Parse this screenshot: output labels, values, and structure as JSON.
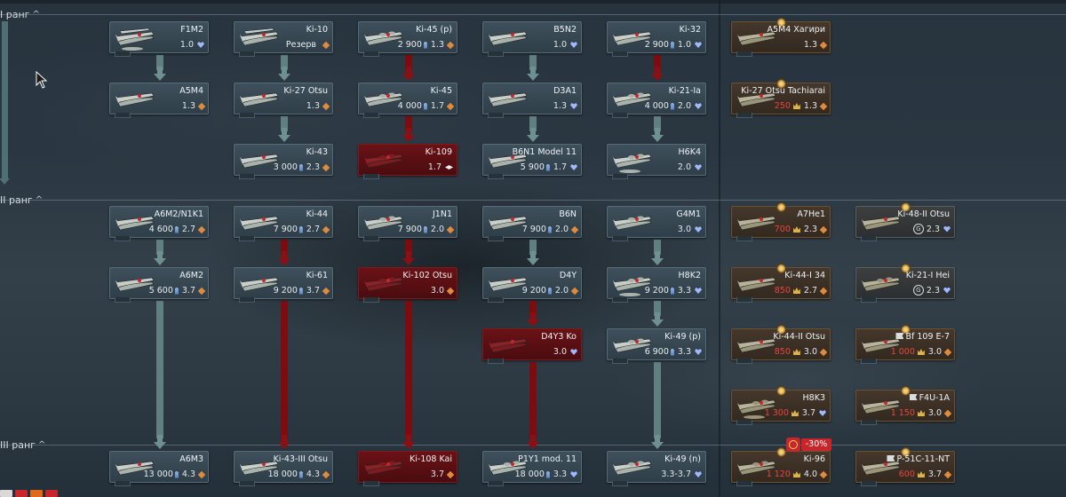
{
  "ranks": [
    {
      "id": "rank1",
      "label": "I ранг"
    },
    {
      "id": "rank2",
      "label": "II ранг"
    },
    {
      "id": "rank3",
      "label": "III ранг"
    }
  ],
  "colors": {
    "research_path": "#5f7f80",
    "premium_path": "#7b0c10",
    "card_regular": "#3a4a55",
    "card_premium_research": "#5a1014",
    "card_premium": "#3e3126",
    "discount_badge": "#c8262a",
    "crown": "#e0b24a"
  },
  "vehicles": {
    "f1m2": {
      "name": "F1M2",
      "cost": "",
      "br": "1.0",
      "type": "heart-icon",
      "plane": "biplane-float-icon"
    },
    "ki10": {
      "name": "Ki-10",
      "cost": "Резерв",
      "br": "",
      "type": "diamond-icon",
      "plane": "biplane-icon"
    },
    "ki45p": {
      "name": "Ki-45 (p)",
      "cost": "2 900",
      "br": "1.3",
      "type": "diamond-icon",
      "plane": "twin-engine-icon"
    },
    "b5n2": {
      "name": "B5N2",
      "cost": "",
      "br": "1.0",
      "type": "heart-icon",
      "plane": "torpedo-bomber-icon"
    },
    "ki32": {
      "name": "Ki-32",
      "cost": "2 900",
      "br": "1.0",
      "type": "heart-icon",
      "plane": "light-bomber-icon"
    },
    "a5m4h": {
      "name": "A5M4 Хагири",
      "cost": "",
      "br": "1.3",
      "type": "diamond-icon",
      "plane": "fighter-icon"
    },
    "a5m4": {
      "name": "A5M4",
      "cost": "",
      "br": "1.3",
      "type": "diamond-icon",
      "plane": "fighter-icon"
    },
    "ki27otsu": {
      "name": "Ki-27 Otsu",
      "cost": "",
      "br": "1.3",
      "type": "diamond-icon",
      "plane": "fighter-icon"
    },
    "ki45": {
      "name": "Ki-45",
      "cost": "4 000",
      "br": "1.7",
      "type": "diamond-icon",
      "plane": "twin-engine-icon"
    },
    "d3a1": {
      "name": "D3A1",
      "cost": "",
      "br": "1.3",
      "type": "heart-icon",
      "plane": "dive-bomber-icon"
    },
    "ki21ia": {
      "name": "Ki-21-Ia",
      "cost": "4 000",
      "br": "2.0",
      "type": "heart-icon",
      "plane": "bomber-icon"
    },
    "ki27tach": {
      "name": "Ki-27 Otsu Tachiarai",
      "cost": "250",
      "br": "1.3",
      "type": "diamond-icon",
      "plane": "fighter-icon"
    },
    "ki43": {
      "name": "Ki-43",
      "cost": "3 000",
      "br": "2.3",
      "type": "diamond-icon",
      "plane": "fighter-icon"
    },
    "ki109": {
      "name": "Ki-109",
      "cost": "",
      "br": "1.7",
      "type": "bomber-icon",
      "plane": "bomber-icon"
    },
    "b6n1": {
      "name": "B6N1 Model 11",
      "cost": "5 900",
      "br": "1.7",
      "type": "heart-icon",
      "plane": "torpedo-bomber-icon"
    },
    "h6k4": {
      "name": "H6K4",
      "cost": "",
      "br": "2.0",
      "type": "heart-icon",
      "plane": "flying-boat-icon"
    },
    "a6m2n1k1": {
      "name": "A6M2/N1K1",
      "cost": "4 600",
      "br": "2.7",
      "type": "diamond-icon",
      "plane": "fighter-icon"
    },
    "ki44": {
      "name": "Ki-44",
      "cost": "7 900",
      "br": "2.7",
      "type": "diamond-icon",
      "plane": "fighter-icon"
    },
    "j1n1": {
      "name": "J1N1",
      "cost": "7 900",
      "br": "2.0",
      "type": "diamond-icon",
      "plane": "twin-engine-icon"
    },
    "b6n": {
      "name": "B6N",
      "cost": "7 900",
      "br": "2.0",
      "type": "diamond-icon",
      "plane": "torpedo-bomber-icon"
    },
    "g4m1": {
      "name": "G4M1",
      "cost": "",
      "br": "3.0",
      "type": "heart-icon",
      "plane": "bomber-icon"
    },
    "a7he1": {
      "name": "A7He1",
      "cost": "700",
      "br": "2.3",
      "type": "diamond-icon",
      "plane": "fighter-icon"
    },
    "ki48": {
      "name": "Ki-48-II Otsu",
      "cost": "",
      "br": "2.3",
      "type": "heart-icon",
      "plane": "light-bomber-icon"
    },
    "a6m2": {
      "name": "A6M2",
      "cost": "5 600",
      "br": "3.7",
      "type": "diamond-icon",
      "plane": "fighter-icon"
    },
    "ki61": {
      "name": "Ki-61",
      "cost": "9 200",
      "br": "3.7",
      "type": "diamond-icon",
      "plane": "fighter-icon"
    },
    "ki102": {
      "name": "Ki-102 Otsu",
      "cost": "",
      "br": "3.0",
      "type": "diamond-icon",
      "plane": "twin-engine-icon"
    },
    "d4y": {
      "name": "D4Y",
      "cost": "9 200",
      "br": "2.0",
      "type": "diamond-icon",
      "plane": "dive-bomber-icon"
    },
    "h8k2": {
      "name": "H8K2",
      "cost": "9 200",
      "br": "3.3",
      "type": "heart-icon",
      "plane": "flying-boat-icon"
    },
    "ki44i34": {
      "name": "Ki-44-I 34",
      "cost": "850",
      "br": "2.7",
      "type": "diamond-icon",
      "plane": "fighter-icon"
    },
    "ki21hei": {
      "name": "Ki-21-I Hei",
      "cost": "",
      "br": "2.3",
      "type": "heart-icon",
      "plane": "bomber-icon"
    },
    "d4y3": {
      "name": "D4Y3 Ko",
      "cost": "",
      "br": "3.0",
      "type": "heart-icon",
      "plane": "dive-bomber-icon"
    },
    "ki49p": {
      "name": "Ki-49 (p)",
      "cost": "6 900",
      "br": "3.3",
      "type": "heart-icon",
      "plane": "bomber-icon"
    },
    "ki44iiotsu": {
      "name": "Ki-44-II Otsu",
      "cost": "850",
      "br": "3.0",
      "type": "diamond-icon",
      "plane": "fighter-icon"
    },
    "bf109e7": {
      "name": "Bf 109 E-7",
      "cost": "1 000",
      "br": "3.0",
      "type": "diamond-icon",
      "plane": "fighter-icon"
    },
    "h8k3": {
      "name": "H8K3",
      "cost": "1 300",
      "br": "3.7",
      "type": "heart-icon",
      "plane": "flying-boat-icon"
    },
    "f4u1a": {
      "name": "F4U-1A",
      "cost": "1 150",
      "br": "3.0",
      "type": "diamond-icon",
      "plane": "fighter-icon"
    },
    "a6m3": {
      "name": "A6M3",
      "cost": "13 000",
      "br": "4.3",
      "type": "diamond-icon",
      "plane": "fighter-icon"
    },
    "ki43iii": {
      "name": "Ki-43-III Otsu",
      "cost": "18 000",
      "br": "4.3",
      "type": "diamond-icon",
      "plane": "fighter-icon"
    },
    "ki108": {
      "name": "Ki-108 Kai",
      "cost": "",
      "br": "3.7",
      "type": "diamond-icon",
      "plane": "twin-engine-icon"
    },
    "p1y1": {
      "name": "P1Y1 mod. 11",
      "cost": "18 000",
      "br": "3.3",
      "type": "heart-icon",
      "plane": "bomber-icon"
    },
    "ki49n": {
      "name": "Ki-49 (n)",
      "cost": "",
      "br": "3.3-3.7",
      "type": "heart-icon",
      "plane": "bomber-icon"
    },
    "ki96": {
      "name": "Ki-96",
      "cost": "1 120",
      "br": "4.0",
      "type": "diamond-icon",
      "plane": "twin-engine-icon"
    },
    "p51c": {
      "name": "P-51C-11-NT",
      "cost": "600",
      "br": "3.7",
      "type": "diamond-icon",
      "plane": "fighter-icon"
    }
  },
  "discount": {
    "label": "-30%"
  }
}
